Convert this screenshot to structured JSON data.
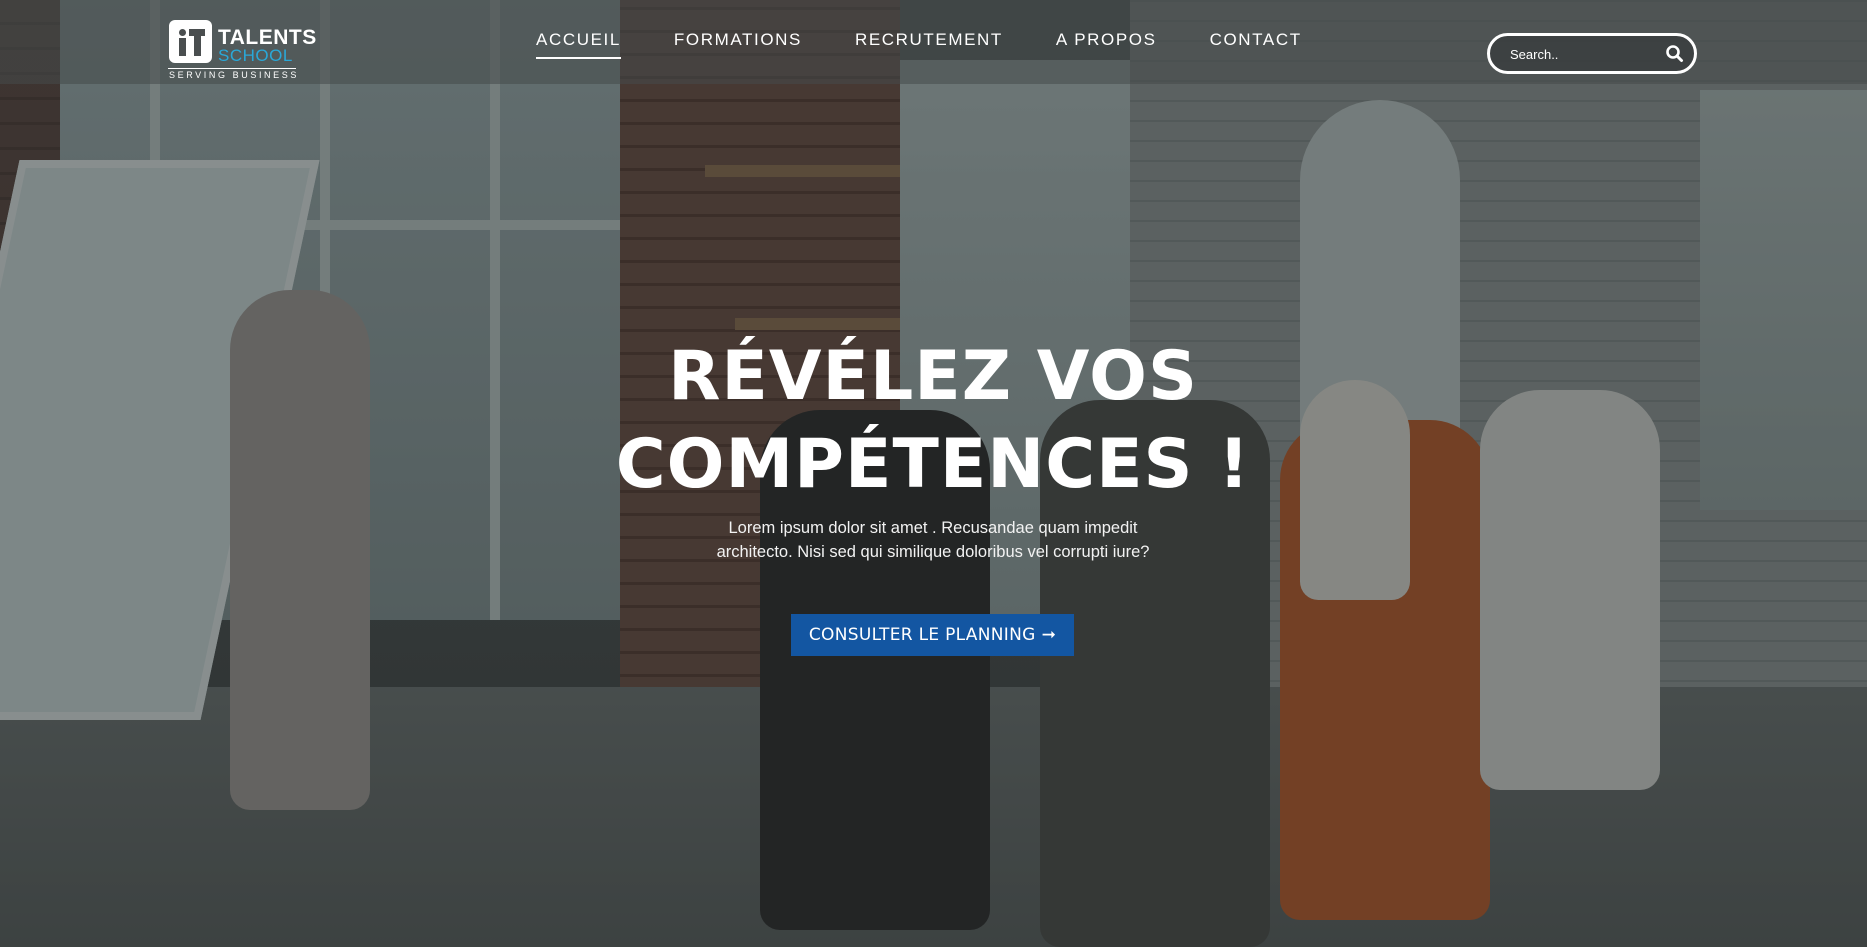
{
  "logo": {
    "word1": "TALENTS",
    "word2": "SCHOOL",
    "tagline": "SERVING BUSINESS"
  },
  "nav": {
    "items": [
      {
        "label": "ACCUEIL",
        "active": true
      },
      {
        "label": "FORMATIONS",
        "active": false
      },
      {
        "label": "RECRUTEMENT",
        "active": false
      },
      {
        "label": "A PROPOS",
        "active": false
      },
      {
        "label": "CONTACT",
        "active": false
      }
    ]
  },
  "search": {
    "placeholder": "Search..",
    "icon": "search-icon"
  },
  "hero": {
    "title_line1": "RÉVÉLEZ VOS",
    "title_line2": "COMPÉTENCES !",
    "text_line1": "Lorem ipsum dolor sit amet . Recusandae quam impedit",
    "text_line2": "architecto. Nisi sed qui similique doloribus vel corrupti iure?",
    "cta_label": "CONSULTER LE PLANNING",
    "cta_arrow": "➞",
    "background": "classroom-photo"
  },
  "colors": {
    "accent": "#1356a2",
    "logo_school": "#2aa8d8",
    "header_bg": "rgba(70,74,75,0.55)"
  }
}
